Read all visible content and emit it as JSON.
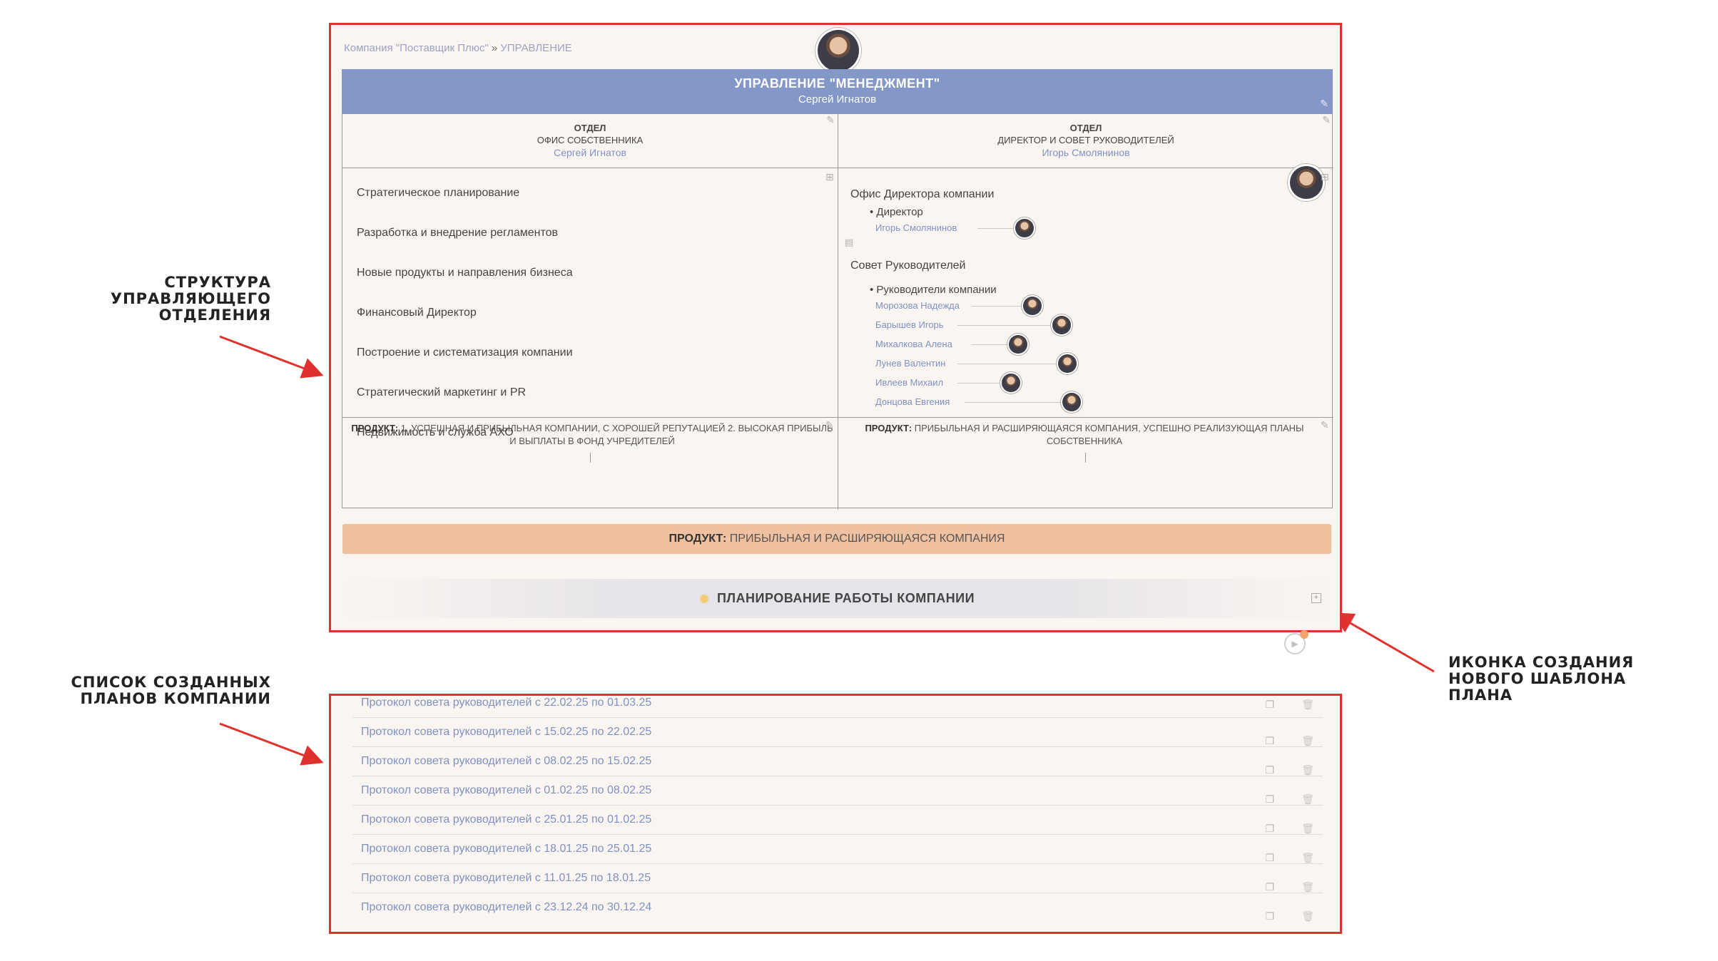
{
  "annotations": {
    "structure": [
      "СТРУКТУРА",
      "УПРАВЛЯЮЩЕГО",
      "ОТДЕЛЕНИЯ"
    ],
    "plans_list": [
      "СПИСОК СОЗДАННЫХ",
      "ПЛАНОВ КОМПАНИИ"
    ],
    "new_template": [
      "ИКОНКА СОЗДАНИЯ",
      "НОВОГО ШАБЛОНА ПЛАНА"
    ],
    "color": "#e0322d"
  },
  "breadcrumb": {
    "company": "Компания \"Поставщик Плюс\"",
    "separator": "»",
    "section": "УПРАВЛЕНИЕ"
  },
  "management": {
    "title": "УПРАВЛЕНИЕ \"МЕНЕДЖМЕНТ\"",
    "head": "Сергей Игнатов",
    "color": "#8497c9"
  },
  "departments": [
    {
      "kind": "ОТДЕЛ",
      "name": "ОФИС СОБСТВЕННИКА",
      "head": "Сергей Игнатов",
      "functions": [
        "Стратегическое планирование",
        "Разработка и внедрение регламентов",
        "Новые продукты и направления бизнеса",
        "Финансовый Директор",
        "Построение и систематизация компании",
        "Стратегический маркетинг и PR",
        "Недвижимость и служба АХО"
      ],
      "product_label": "ПРОДУКТ:",
      "product_text": "1. УСПЕШНАЯ И ПРИБЫЛЬНАЯ КОМПАНИИ, С ХОРОШЕЙ РЕПУТАЦИЕЙ 2. ВЫСОКАЯ ПРИБЫЛЬ И ВЫПЛАТЫ В ФОНД УЧРЕДИТЕЛЕЙ"
    },
    {
      "kind": "ОТДЕЛ",
      "name": "ДИРЕКТОР И СОВЕТ РУКОВОДИТЕЛЕЙ",
      "head": "Игорь Смолянинов",
      "sections": [
        {
          "title": "Офис Директора компании",
          "role": "Директор",
          "people": [
            "Игорь Смолянинов"
          ]
        },
        {
          "title": "Совет Руководителей",
          "role": "Руководители компании",
          "people": [
            "Морозова Надежда",
            "Барышев Игорь",
            "Михалкова Алена",
            "Лунев Валентин",
            "Ивлеев Михаил",
            "Донцова Евгения"
          ]
        }
      ],
      "product_label": "ПРОДУКТ:",
      "product_text": "ПРИБЫЛЬНАЯ И РАСШИРЯЮЩАЯСЯ КОМПАНИЯ, УСПЕШНО РЕАЛИЗУЮЩАЯ ПЛАНЫ СОБСТВЕННИКА"
    }
  ],
  "overall_product": {
    "label": "ПРОДУКТ:",
    "text": "ПРИБЫЛЬНАЯ И РАСШИРЯЮЩАЯСЯ КОМПАНИЯ",
    "color": "#efc1a1"
  },
  "planning": {
    "title": "ПЛАНИРОВАНИЕ РАБОТЫ КОМПАНИИ",
    "add_icon": "plus-square-icon"
  },
  "plans": [
    "Протокол совета руководителей с 22.02.25 по 01.03.25",
    "Протокол совета руководителей с 15.02.25 по 22.02.25",
    "Протокол совета руководителей с 08.02.25 по 15.02.25",
    "Протокол совета руководителей с 01.02.25 по 08.02.25",
    "Протокол совета руководителей с 25.01.25 по 01.02.25",
    "Протокол совета руководителей с 18.01.25 по 25.01.25",
    "Протокол совета руководителей с 11.01.25 по 18.01.25",
    "Протокол совета руководителей с 23.12.24 по 30.12.24"
  ],
  "icons": {
    "copy": "copy-icon",
    "trash": "trash-icon",
    "edit": "edit-icon",
    "play": "play-icon"
  }
}
